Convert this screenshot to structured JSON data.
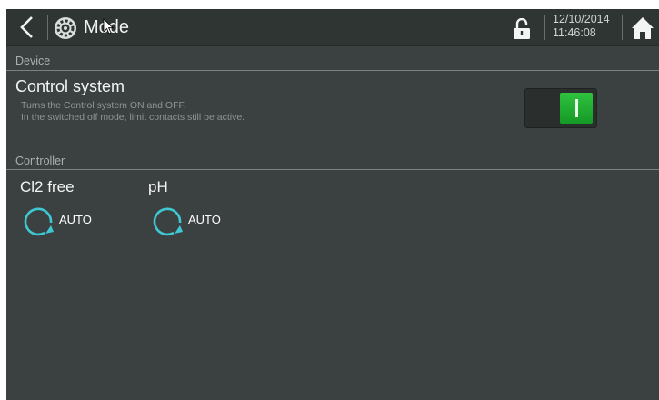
{
  "header": {
    "title": "Mode",
    "date": "12/10/2014",
    "time": "11:46:08",
    "icons": [
      "back-arrow-icon",
      "gear-icon",
      "unlock-icon",
      "home-icon"
    ]
  },
  "device": {
    "section_label": "Device",
    "control_system": {
      "title": "Control system",
      "desc_line1": "Turns the Control system ON and OFF.",
      "desc_line2": "In the switched off mode, limit contacts still be active.",
      "switch_on": true
    }
  },
  "controller": {
    "section_label": "Controller",
    "items": [
      {
        "name": "Cl2 free",
        "mode": "AUTO"
      },
      {
        "name": "pH",
        "mode": "AUTO"
      }
    ]
  },
  "colors": {
    "accent": "#3fc7d3",
    "switch_on": "#1fae33",
    "background": "#3b4140"
  }
}
